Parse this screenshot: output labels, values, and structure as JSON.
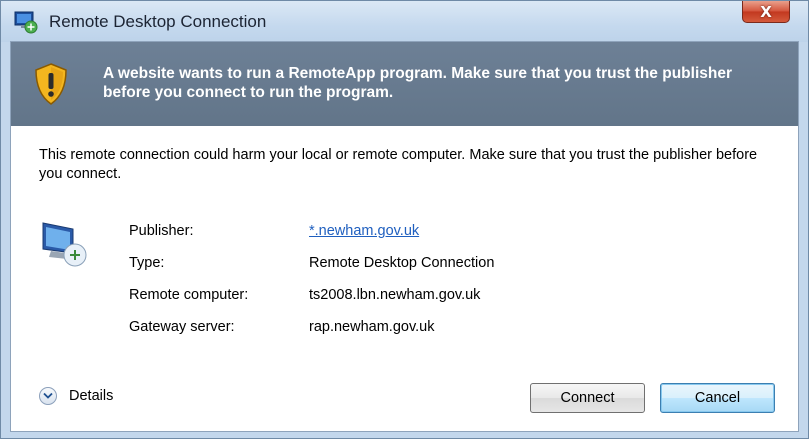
{
  "window": {
    "title": "Remote Desktop Connection",
    "close_glyph": "X",
    "icons": {
      "title": "remote-desktop-icon",
      "close": "close-icon",
      "warning": "warning-shield-icon",
      "computer": "remote-computer-icon",
      "details": "chevron-down-icon"
    }
  },
  "banner": {
    "text": "A website wants to run a RemoteApp program. Make sure that you trust the publisher before you connect to run the program."
  },
  "message": "This remote connection could harm your local or remote computer. Make sure that you trust the publisher before you connect.",
  "info": [
    {
      "label": "Publisher:",
      "value": "*.newham.gov.uk"
    },
    {
      "label": "Type:",
      "value": "Remote Desktop Connection"
    },
    {
      "label": "Remote computer:",
      "value": "ts2008.lbn.newham.gov.uk"
    },
    {
      "label": "Gateway server:",
      "value": "rap.newham.gov.uk"
    }
  ],
  "details": {
    "label": "Details"
  },
  "buttons": {
    "connect": "Connect",
    "cancel": "Cancel"
  },
  "colors": {
    "banner": "#6d8096",
    "link": "#1f5fbf",
    "close": "#d3533a"
  }
}
